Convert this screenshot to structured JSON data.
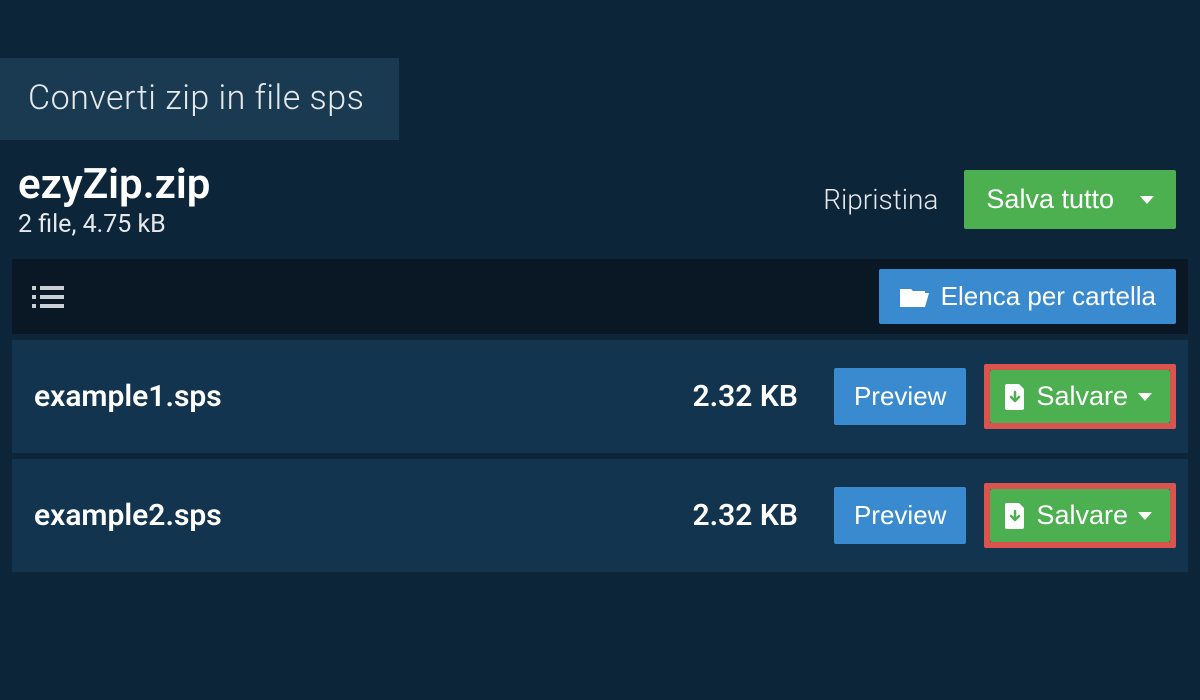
{
  "tab": {
    "title": "Converti zip in file sps"
  },
  "file": {
    "name": "ezyZip.zip",
    "meta": "2 file, 4.75 kB"
  },
  "actions": {
    "reset": "Ripristina",
    "save_all": "Salva tutto",
    "list_by_folder": "Elenca per cartella"
  },
  "rows": [
    {
      "name": "example1.sps",
      "size": "2.32 KB",
      "preview": "Preview",
      "save": "Salvare"
    },
    {
      "name": "example2.sps",
      "size": "2.32 KB",
      "preview": "Preview",
      "save": "Salvare"
    }
  ]
}
